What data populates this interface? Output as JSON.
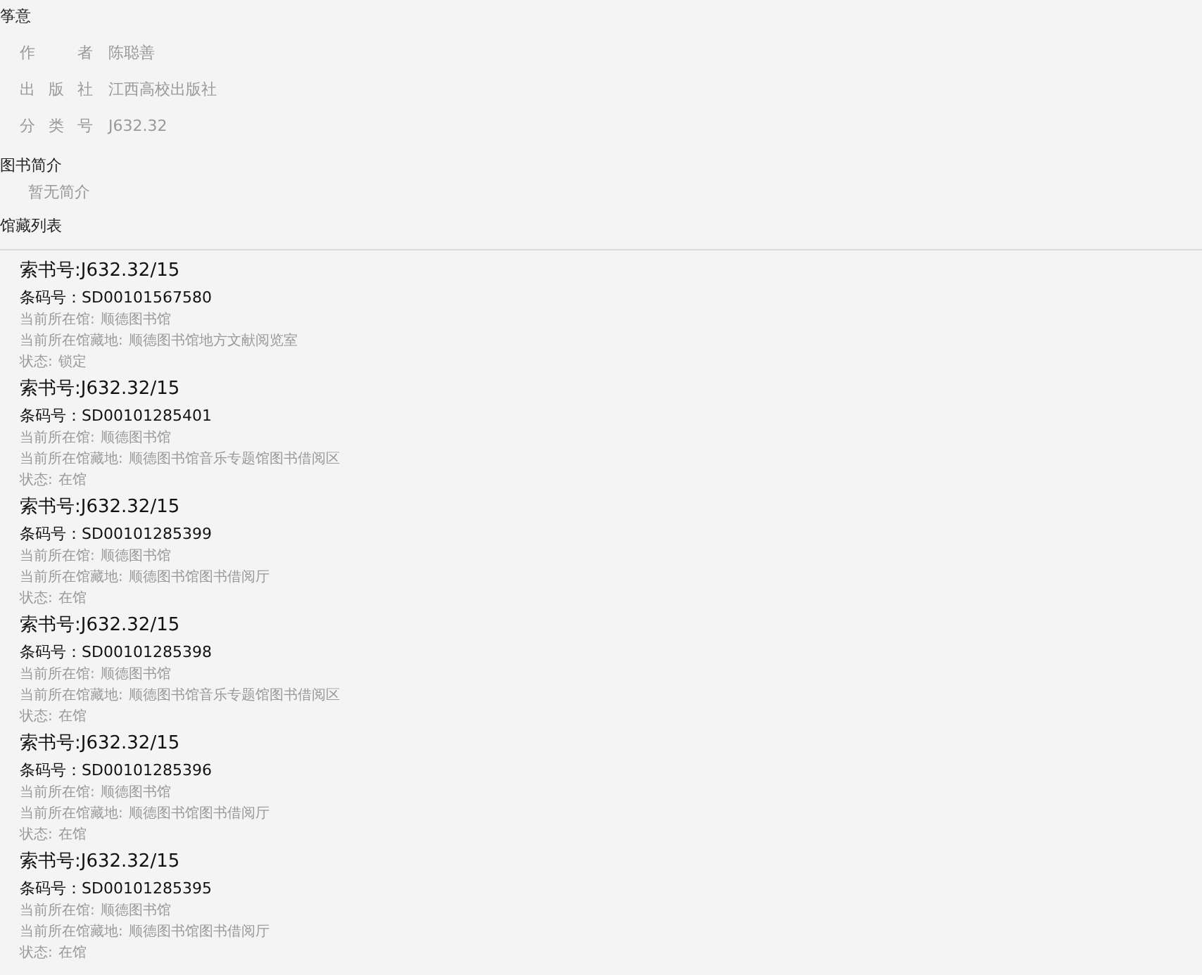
{
  "book": {
    "title": "筝意",
    "fields": [
      {
        "label": "作者",
        "value": "陈聪善"
      },
      {
        "label": "出版社",
        "value": "江西高校出版社"
      },
      {
        "label": "分类号",
        "value": "J632.32"
      }
    ]
  },
  "intro": {
    "heading": "图书简介",
    "text": "暂无简介"
  },
  "holdings": {
    "heading": "馆藏列表",
    "items": [
      {
        "call_number": "索书号:J632.32/15",
        "barcode": "条码号：SD00101567580",
        "library_label": "当前所在馆:",
        "library": "顺德图书馆",
        "location_label": "当前所在馆藏地:",
        "location": "顺德图书馆地方文献阅览室",
        "status_label": "状态:",
        "status": "锁定"
      },
      {
        "call_number": "索书号:J632.32/15",
        "barcode": "条码号：SD00101285401",
        "library_label": "当前所在馆:",
        "library": "顺德图书馆",
        "location_label": "当前所在馆藏地:",
        "location": "顺德图书馆音乐专题馆图书借阅区",
        "status_label": "状态:",
        "status": "在馆"
      },
      {
        "call_number": "索书号:J632.32/15",
        "barcode": "条码号：SD00101285399",
        "library_label": "当前所在馆:",
        "library": "顺德图书馆",
        "location_label": "当前所在馆藏地:",
        "location": "顺德图书馆图书借阅厅",
        "status_label": "状态:",
        "status": "在馆"
      },
      {
        "call_number": "索书号:J632.32/15",
        "barcode": "条码号：SD00101285398",
        "library_label": "当前所在馆:",
        "library": "顺德图书馆",
        "location_label": "当前所在馆藏地:",
        "location": "顺德图书馆音乐专题馆图书借阅区",
        "status_label": "状态:",
        "status": "在馆"
      },
      {
        "call_number": "索书号:J632.32/15",
        "barcode": "条码号：SD00101285396",
        "library_label": "当前所在馆:",
        "library": "顺德图书馆",
        "location_label": "当前所在馆藏地:",
        "location": "顺德图书馆图书借阅厅",
        "status_label": "状态:",
        "status": "在馆"
      },
      {
        "call_number": "索书号:J632.32/15",
        "barcode": "条码号：SD00101285395",
        "library_label": "当前所在馆:",
        "library": "顺德图书馆",
        "location_label": "当前所在馆藏地:",
        "location": "顺德图书馆图书借阅厅",
        "status_label": "状态:",
        "status": "在馆"
      }
    ]
  }
}
